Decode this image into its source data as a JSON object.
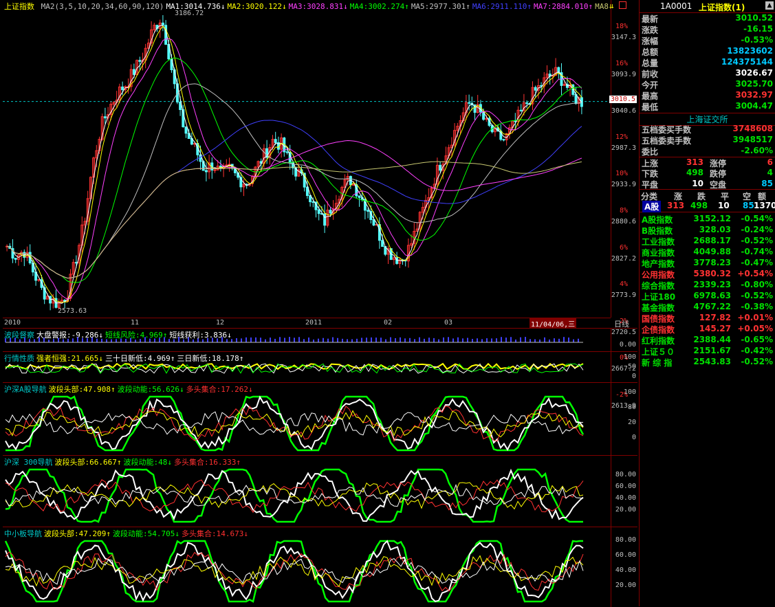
{
  "main": {
    "title": "上证指数",
    "ma_legend": [
      {
        "t": "MA2(3,5,10,20,34,60,90,120)",
        "c": "#c0c0c0"
      },
      {
        "t": "MA1:3014.736↓",
        "c": "#ffffff"
      },
      {
        "t": "MA2:3020.122↓",
        "c": "#ffff00"
      },
      {
        "t": "MA3:3028.831↓",
        "c": "#ff40ff"
      },
      {
        "t": "MA4:3002.274↑",
        "c": "#00ff00"
      },
      {
        "t": "MA5:2977.301↑",
        "c": "#c0c0c0"
      },
      {
        "t": "MA6:2911.110↑",
        "c": "#4040ff"
      },
      {
        "t": "MA7:2884.010↑",
        "c": "#ff40ff"
      },
      {
        "t": "MA8:2902.995↑",
        "c": "#c8c870"
      }
    ],
    "high_label": "3186.72",
    "low_label": "2573.63",
    "price_ticks": [
      "3147.3",
      "3093.9",
      "3040.6",
      "2987.3",
      "2933.9",
      "2880.6",
      "2827.2",
      "2773.9",
      "2720.5",
      "2667.2",
      "2613.9"
    ],
    "pct_ticks": [
      "18%",
      "16%",
      "14%",
      "12%",
      "10%",
      "8%",
      "6%",
      "4%",
      "2%",
      "0%",
      "-2%"
    ],
    "current_price": "3010.5",
    "x_labels": [
      "2010",
      "11",
      "12",
      "2011",
      "02",
      "03"
    ],
    "date_cursor": "11/04/06,三",
    "period": "日线"
  },
  "ind1": {
    "name": "波段督察",
    "items": [
      {
        "t": "大盘警报:-9.286↓",
        "c": "#ffffff"
      },
      {
        "t": "短线风险:4.969↑",
        "c": "#00ff00"
      },
      {
        "t": "短线获利:3.836↓",
        "c": "#ffffff"
      }
    ],
    "ticks": [
      "0.00"
    ]
  },
  "ind2": {
    "name": "行情性质",
    "items": [
      {
        "t": "强者恒强:21.665↓",
        "c": "#ffff00"
      },
      {
        "t": "三十日新低:4.969↑",
        "c": "#ffffff"
      },
      {
        "t": "三日新低:18.178↑",
        "c": "#ffffff"
      }
    ],
    "ticks": [
      "100",
      "50",
      "0"
    ]
  },
  "ind3": {
    "name": "沪深A股导航",
    "items": [
      {
        "t": "波段头部:47.908↑",
        "c": "#ffff00"
      },
      {
        "t": "波段动能:56.626↓",
        "c": "#00ff00"
      },
      {
        "t": "多头集合:17.262↓",
        "c": "#ff3030"
      }
    ],
    "ticks": [
      "100",
      "80",
      "20",
      "0"
    ]
  },
  "ind4": {
    "name": "沪深 300导航",
    "items": [
      {
        "t": "波段头部:66.667↑",
        "c": "#ffff00"
      },
      {
        "t": "波段动能:48↓",
        "c": "#00ff00"
      },
      {
        "t": "多头集合:16.333↑",
        "c": "#ff3030"
      }
    ],
    "ticks": [
      "80.00",
      "60.00",
      "40.00",
      "20.00"
    ]
  },
  "ind5": {
    "name": "中小板导航",
    "items": [
      {
        "t": "波段头部:47.209↑",
        "c": "#ffff00"
      },
      {
        "t": "波段动能:54.705↓",
        "c": "#00ff00"
      },
      {
        "t": "多头集合:14.673↓",
        "c": "#ff3030"
      }
    ],
    "ticks": [
      "80.00",
      "60.00",
      "40.00",
      "20.00"
    ]
  },
  "quote": {
    "code": "1A0001",
    "name": "上证指数(1)",
    "rows": [
      {
        "k": "最新",
        "v": "3010.52",
        "c": "grn"
      },
      {
        "k": "涨跌",
        "v": "-16.15",
        "c": "grn"
      },
      {
        "k": "涨幅",
        "v": "-0.53%",
        "c": "grn"
      },
      {
        "k": "总额",
        "v": "13823602",
        "c": "cyan"
      },
      {
        "k": "总量",
        "v": "124375144",
        "c": "cyan"
      },
      {
        "k": "前收",
        "v": "3026.67",
        "c": "wht"
      },
      {
        "k": "今开",
        "v": "3025.70",
        "c": "grn"
      },
      {
        "k": "最高",
        "v": "3032.97",
        "c": "red"
      },
      {
        "k": "最低",
        "v": "3004.47",
        "c": "grn"
      }
    ],
    "exchange": "上海证交所",
    "book": [
      {
        "k": "五档委买手数",
        "v": "3748608",
        "c": "red"
      },
      {
        "k": "五档委卖手数",
        "v": "3948517",
        "c": "grn"
      },
      {
        "k": "委比",
        "v": "-2.60%",
        "c": "grn"
      }
    ],
    "breadth": [
      {
        "a": "上涨",
        "av": "313",
        "ac": "red",
        "b": "涨停",
        "bv": "6",
        "bc": "red"
      },
      {
        "a": "下跌",
        "av": "498",
        "ac": "grn",
        "b": "跌停",
        "bv": "4",
        "bc": "grn"
      },
      {
        "a": "平盘",
        "av": "10",
        "ac": "wht",
        "b": "空盘",
        "bv": "85",
        "bc": "cyan"
      }
    ],
    "cat_header": [
      "分类",
      "涨",
      "跌",
      "平",
      "空",
      "额"
    ],
    "cat_row": {
      "name": "A股",
      "up": "313",
      "down": "498",
      "flat": "10",
      "empty": "85",
      "amt": "1370"
    },
    "indices": [
      {
        "n": "A股指数",
        "p": "3152.12",
        "c": "-0.54%",
        "col": "grn"
      },
      {
        "n": "B股指数",
        "p": "328.03",
        "c": "-0.24%",
        "col": "grn"
      },
      {
        "n": "工业指数",
        "p": "2688.17",
        "c": "-0.52%",
        "col": "grn"
      },
      {
        "n": "商业指数",
        "p": "4049.88",
        "c": "-0.74%",
        "col": "grn"
      },
      {
        "n": "地产指数",
        "p": "3778.23",
        "c": "-0.47%",
        "col": "grn"
      },
      {
        "n": "公用指数",
        "p": "5380.32",
        "c": "+0.54%",
        "col": "red"
      },
      {
        "n": "综合指数",
        "p": "2339.23",
        "c": "-0.80%",
        "col": "grn"
      },
      {
        "n": "上证180",
        "p": "6978.63",
        "c": "-0.52%",
        "col": "grn"
      },
      {
        "n": "基金指数",
        "p": "4767.22",
        "c": "-0.38%",
        "col": "grn"
      },
      {
        "n": "国债指数",
        "p": "127.82",
        "c": "+0.01%",
        "col": "red"
      },
      {
        "n": "企债指数",
        "p": "145.27",
        "c": "+0.05%",
        "col": "red"
      },
      {
        "n": "红利指数",
        "p": "2388.44",
        "c": "-0.65%",
        "col": "grn"
      },
      {
        "n": "上证５０",
        "p": "2151.67",
        "c": "-0.42%",
        "col": "grn"
      },
      {
        "n": "新 综 指",
        "p": "2543.83",
        "c": "-0.52%",
        "col": "grn"
      }
    ]
  },
  "chart_data": {
    "type": "line",
    "title": "上证指数",
    "ylim": [
      2590,
      3200
    ],
    "close_points": [
      2710,
      2690,
      2700,
      2660,
      2620,
      2600,
      2590,
      2610,
      2680,
      2760,
      2880,
      2960,
      3000,
      3030,
      3050,
      3080,
      3110,
      3160,
      3186,
      3100,
      2990,
      2940,
      2910,
      2870,
      2880,
      2860,
      2870,
      2850,
      2840,
      2870,
      2900,
      2930,
      2920,
      2880,
      2860,
      2830,
      2780,
      2760,
      2800,
      2830,
      2850,
      2820,
      2790,
      2750,
      2710,
      2690,
      2680,
      2710,
      2760,
      2810,
      2860,
      2900,
      2940,
      2980,
      3010,
      2990,
      2960,
      2940,
      2930,
      2960,
      2990,
      3020,
      3040,
      3060,
      3070,
      3050,
      3020,
      3010
    ],
    "grid": false
  }
}
